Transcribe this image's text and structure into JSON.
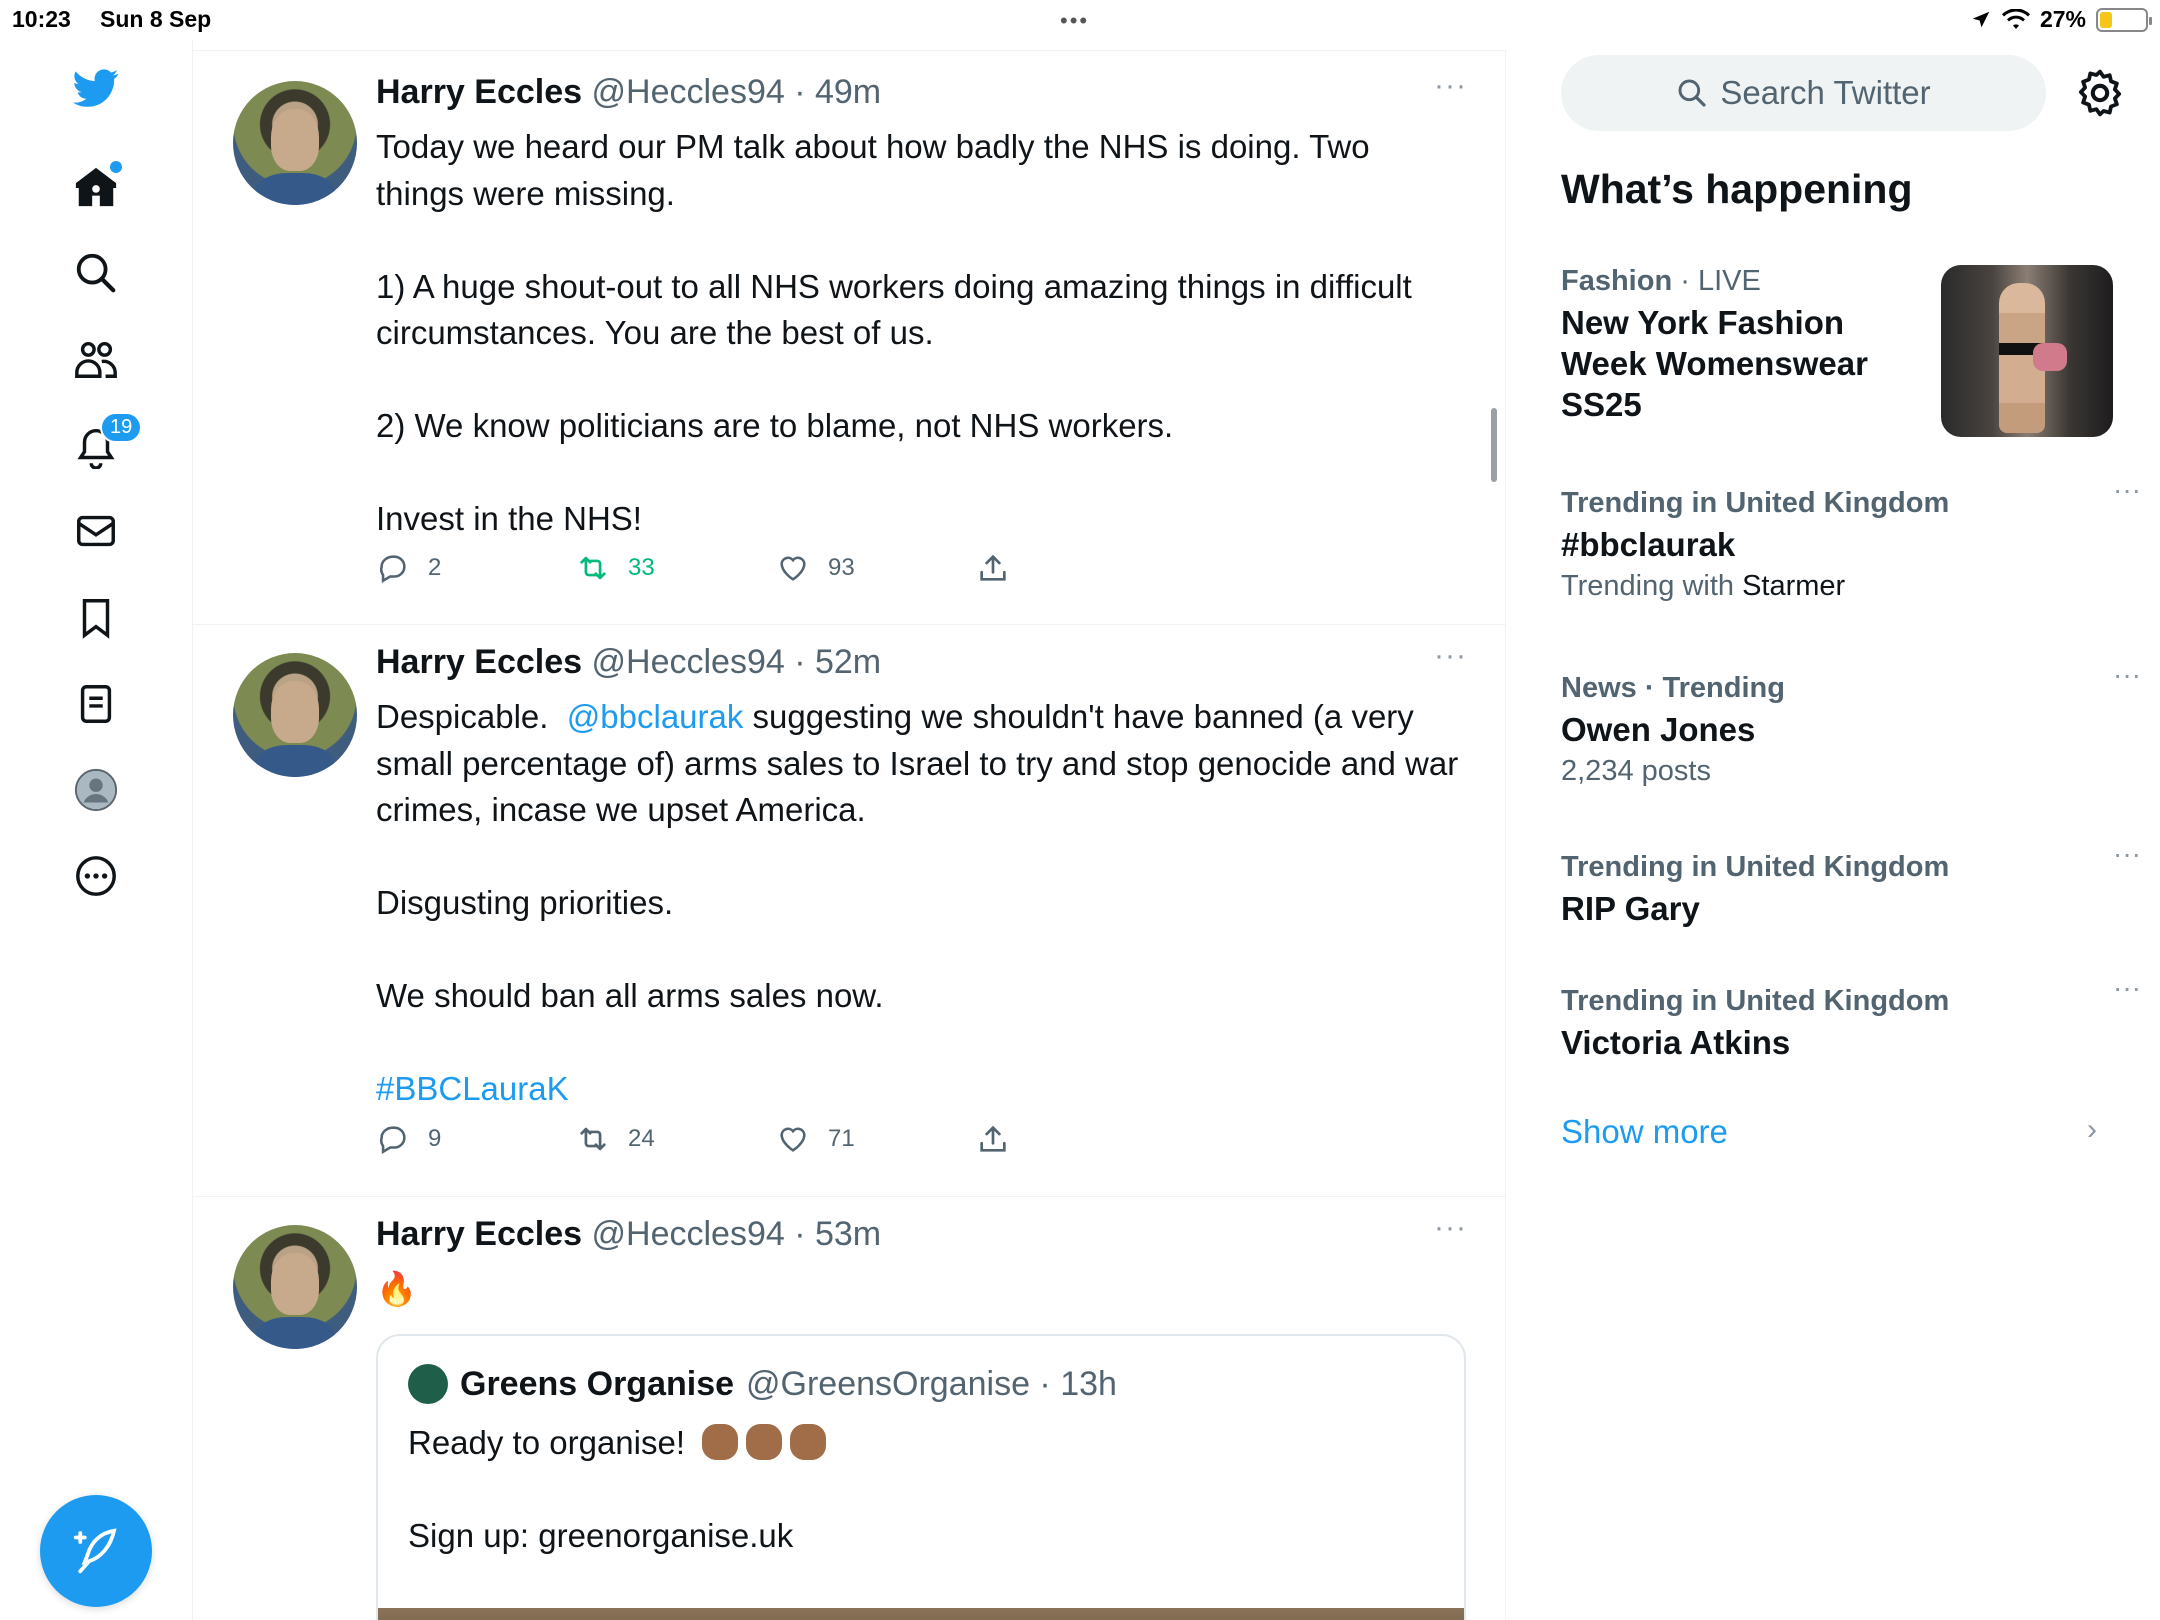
{
  "status": {
    "time": "10:23",
    "date": "Sun 8 Sep",
    "battery": "27%",
    "battery_level": 0.27
  },
  "nav": {
    "notifications_count": "19"
  },
  "tweets": [
    {
      "name": "Harry Eccles",
      "meta": "@Heccles94 · 49m",
      "lines": [
        "Today we heard our PM talk about how badly the NHS is doing. Two things were missing.",
        "1) A huge shout-out to all NHS workers doing amazing things in difficult circumstances. You are the best of us.",
        "2) We know politicians are to blame, not NHS workers.",
        "Invest in the NHS!"
      ],
      "replies": "2",
      "retweets": "33",
      "likes": "93"
    },
    {
      "name": "Harry Eccles",
      "meta": "@Heccles94 · 52m",
      "lines": [
        "Despicable.",
        "@bbclaurak",
        "suggesting we shouldn't have banned (a very small percentage of) arms sales to Israel to try and stop genocide and war crimes, incase we upset America.",
        "Disgusting priorities.",
        "We should ban all arms sales now.",
        "#BBCLauraK"
      ],
      "replies": "9",
      "retweets": "24",
      "likes": "71"
    },
    {
      "name": "Harry Eccles",
      "meta": "@Heccles94 · 53m",
      "emoji": "🔥",
      "quote": {
        "name": "Greens Organise",
        "meta": "@GreensOrganise · 13h",
        "line1": "Ready to organise!",
        "line2": "Sign up: greenorganise.uk"
      }
    }
  ],
  "sidebar": {
    "search_placeholder": "Search Twitter",
    "title": "What’s happening",
    "trends": [
      {
        "cat": "Fashion",
        "cat_extra": " · LIVE",
        "title": "New York Fashion Week Womenswear SS25"
      },
      {
        "cat": "Trending in United Kingdom",
        "title": "#bbclaurak",
        "sub": "Trending with",
        "sub_bold": "Starmer"
      },
      {
        "cat": "News · Trending",
        "title": "Owen Jones",
        "sub": "2,234 posts"
      },
      {
        "cat": "Trending in United Kingdom",
        "title": "RIP Gary"
      },
      {
        "cat": "Trending in United Kingdom",
        "title": "Victoria Atkins"
      }
    ],
    "show_more": "Show more"
  }
}
